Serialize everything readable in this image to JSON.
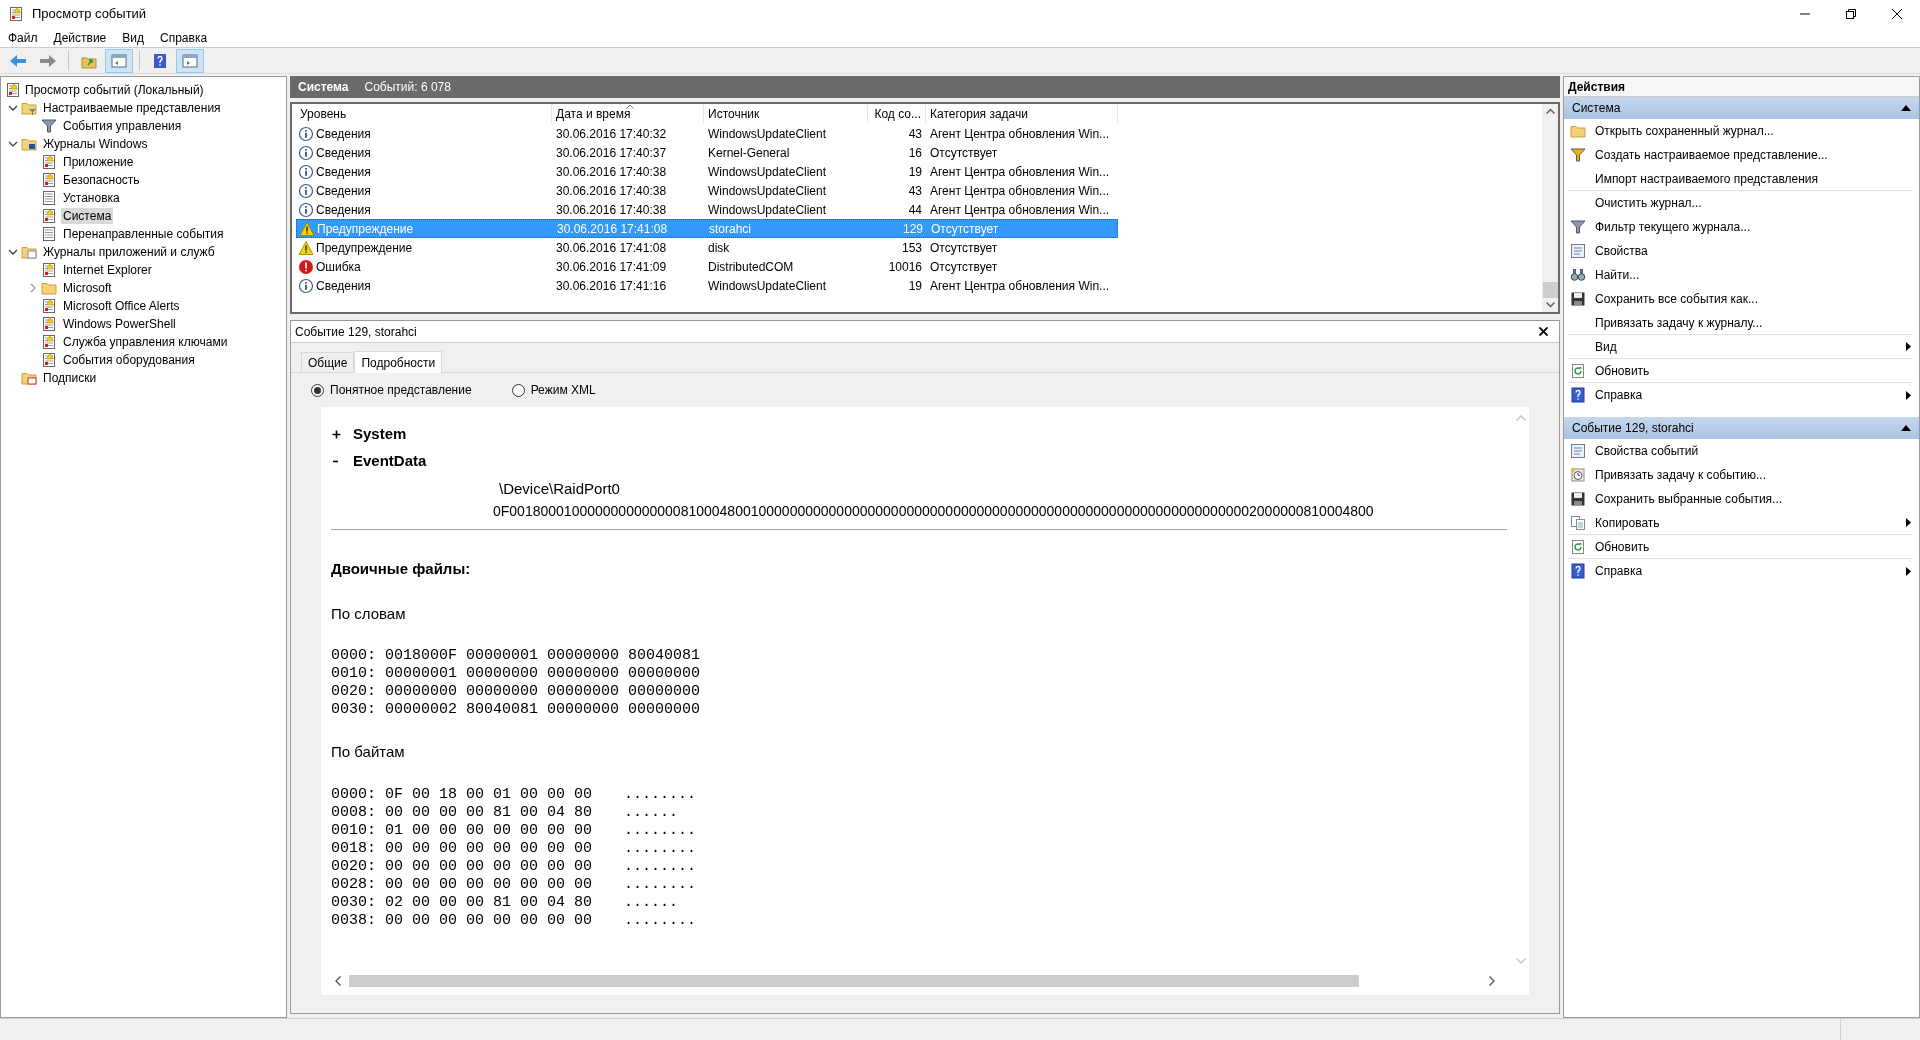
{
  "window": {
    "title": "Просмотр событий"
  },
  "menu": [
    "Файл",
    "Действие",
    "Вид",
    "Справка"
  ],
  "toolbar": [
    {
      "kind": "back",
      "pressed": false
    },
    {
      "kind": "forward",
      "pressed": false
    },
    {
      "kind": "up",
      "pressed": false
    },
    {
      "kind": "tree",
      "pressed": true
    },
    {
      "kind": "help",
      "pressed": false
    },
    {
      "kind": "actions",
      "pressed": true
    }
  ],
  "tree": [
    {
      "label": "Просмотр событий (Локальный)",
      "kind": "root",
      "selected": false,
      "children": [
        {
          "label": "Настраиваемые представления",
          "kind": "folder-filter",
          "selected": false,
          "expanded": true,
          "children": [
            {
              "label": "События управления",
              "kind": "filter",
              "selected": false
            }
          ]
        },
        {
          "label": "Журналы Windows",
          "kind": "folder-pc",
          "selected": false,
          "expanded": true,
          "children": [
            {
              "label": "Приложение",
              "kind": "log",
              "selected": false
            },
            {
              "label": "Безопасность",
              "kind": "log",
              "selected": false
            },
            {
              "label": "Установка",
              "kind": "plain-log",
              "selected": false
            },
            {
              "label": "Система",
              "kind": "log",
              "selected": true
            },
            {
              "label": "Перенаправленные события",
              "kind": "plain-log",
              "selected": false
            }
          ]
        },
        {
          "label": "Журналы приложений и служб",
          "kind": "folder-win",
          "selected": false,
          "expanded": true,
          "children": [
            {
              "label": "Internet Explorer",
              "kind": "log",
              "selected": false
            },
            {
              "label": "Microsoft",
              "kind": "folder",
              "selected": false,
              "expanded": false
            },
            {
              "label": "Microsoft Office Alerts",
              "kind": "log",
              "selected": false
            },
            {
              "label": "Windows PowerShell",
              "kind": "log",
              "selected": false
            },
            {
              "label": "Служба управления ключами",
              "kind": "log",
              "selected": false
            },
            {
              "label": "События оборудования",
              "kind": "log",
              "selected": false
            }
          ]
        },
        {
          "label": "Подписки",
          "kind": "subscriptions",
          "selected": false
        }
      ]
    }
  ],
  "log_header": {
    "name": "Система",
    "count": "Событий: 6 078"
  },
  "table": {
    "columns": [
      "Уровень",
      "Дата и время",
      "Источник",
      "Код со...",
      "Категория задачи"
    ],
    "rows": [
      {
        "kind": "info",
        "level": "Сведения",
        "date": "30.06.2016 17:40:32",
        "source": "WindowsUpdateClient",
        "code": "43",
        "category": "Агент Центра обновления Win...",
        "selected": false
      },
      {
        "kind": "info",
        "level": "Сведения",
        "date": "30.06.2016 17:40:37",
        "source": "Kernel-General",
        "code": "16",
        "category": "Отсутствует",
        "selected": false
      },
      {
        "kind": "info",
        "level": "Сведения",
        "date": "30.06.2016 17:40:38",
        "source": "WindowsUpdateClient",
        "code": "19",
        "category": "Агент Центра обновления Win...",
        "selected": false
      },
      {
        "kind": "info",
        "level": "Сведения",
        "date": "30.06.2016 17:40:38",
        "source": "WindowsUpdateClient",
        "code": "43",
        "category": "Агент Центра обновления Win...",
        "selected": false
      },
      {
        "kind": "info",
        "level": "Сведения",
        "date": "30.06.2016 17:40:38",
        "source": "WindowsUpdateClient",
        "code": "44",
        "category": "Агент Центра обновления Win...",
        "selected": false
      },
      {
        "kind": "warning",
        "level": "Предупреждение",
        "date": "30.06.2016 17:41:08",
        "source": "storahci",
        "code": "129",
        "category": "Отсутствует",
        "selected": true
      },
      {
        "kind": "warning",
        "level": "Предупреждение",
        "date": "30.06.2016 17:41:08",
        "source": "disk",
        "code": "153",
        "category": "Отсутствует",
        "selected": false
      },
      {
        "kind": "error",
        "level": "Ошибка",
        "date": "30.06.2016 17:41:09",
        "source": "DistributedCOM",
        "code": "10016",
        "category": "Отсутствует",
        "selected": false
      },
      {
        "kind": "info",
        "level": "Сведения",
        "date": "30.06.2016 17:41:16",
        "source": "WindowsUpdateClient",
        "code": "19",
        "category": "Агент Центра обновления Win...",
        "selected": false
      }
    ]
  },
  "detail": {
    "title": "Событие 129, storahci",
    "tabs": [
      {
        "label": "Общие",
        "selected": false
      },
      {
        "label": "Подробности",
        "selected": true
      }
    ],
    "modes": [
      {
        "label": "Понятное представление",
        "selected": true
      },
      {
        "label": "Режим XML",
        "selected": false
      }
    ],
    "sections": [
      {
        "label": "System",
        "expanded": false
      },
      {
        "label": "EventData",
        "expanded": true
      }
    ],
    "event_data": [
      "\\Device\\RaidPort0",
      "0F001800010000000000000081000480010000000000000000000000000000000000000000000000000000000000000002000000810004800"
    ],
    "binary_heading": "Двоичные файлы:",
    "words_heading": "По словам",
    "words": [
      "0000: 0018000F 00000001 00000000 80040081",
      "0010: 00000001 00000000 00000000 00000000",
      "0020: 00000000 00000000 00000000 00000000",
      "0030: 00000002 80040081 00000000 00000000"
    ],
    "bytes_heading": "По байтам",
    "bytes": [
      {
        "hex": "0000: 0F 00 18 00 01 00 00 00",
        "ascii": "........"
      },
      {
        "hex": "0008: 00 00 00 00 81 00 04 80",
        "ascii": "......"
      },
      {
        "hex": "0010: 01 00 00 00 00 00 00 00",
        "ascii": "........"
      },
      {
        "hex": "0018: 00 00 00 00 00 00 00 00",
        "ascii": "........"
      },
      {
        "hex": "0020: 00 00 00 00 00 00 00 00",
        "ascii": "........"
      },
      {
        "hex": "0028: 00 00 00 00 00 00 00 00",
        "ascii": "........"
      },
      {
        "hex": "0030: 02 00 00 00 81 00 04 80",
        "ascii": "......"
      },
      {
        "hex": "0038: 00 00 00 00 00 00 00 00",
        "ascii": "........"
      }
    ]
  },
  "actions": {
    "title": "Действия",
    "groups": [
      {
        "title": "Система",
        "expanded": true,
        "items": [
          {
            "label": "Открыть сохраненный журнал...",
            "kind": "open",
            "submenu": false,
            "separator": false
          },
          {
            "label": "Создать настраиваемое представление...",
            "kind": "new-filter",
            "submenu": false,
            "separator": false
          },
          {
            "label": "Импорт настраиваемого представления",
            "kind": "plain",
            "submenu": false,
            "separator": true
          },
          {
            "label": "Очистить журнал...",
            "kind": "plain",
            "submenu": false,
            "separator": false
          },
          {
            "label": "Фильтр текущего журнала...",
            "kind": "filter",
            "submenu": false,
            "separator": false
          },
          {
            "label": "Свойства",
            "kind": "properties",
            "submenu": false,
            "separator": false
          },
          {
            "label": "Найти...",
            "kind": "find",
            "submenu": false,
            "separator": false
          },
          {
            "label": "Сохранить все события как...",
            "kind": "save",
            "submenu": false,
            "separator": false
          },
          {
            "label": "Привязать задачу к журналу...",
            "kind": "plain",
            "submenu": false,
            "separator": true
          },
          {
            "label": "Вид",
            "kind": "plain",
            "submenu": true,
            "separator": true
          },
          {
            "label": "Обновить",
            "kind": "refresh",
            "submenu": false,
            "separator": true
          },
          {
            "label": "Справка",
            "kind": "help",
            "submenu": true,
            "separator": false
          }
        ]
      },
      {
        "title": "Событие 129, storahci",
        "expanded": true,
        "items": [
          {
            "label": "Свойства событий",
            "kind": "properties",
            "submenu": false,
            "separator": false
          },
          {
            "label": "Привязать задачу к событию...",
            "kind": "task",
            "submenu": false,
            "separator": false
          },
          {
            "label": "Сохранить выбранные события...",
            "kind": "save",
            "submenu": false,
            "separator": false
          },
          {
            "label": "Копировать",
            "kind": "copy",
            "submenu": true,
            "separator": true
          },
          {
            "label": "Обновить",
            "kind": "refresh",
            "submenu": false,
            "separator": true
          },
          {
            "label": "Справка",
            "kind": "help",
            "submenu": true,
            "separator": false
          }
        ]
      }
    ]
  }
}
